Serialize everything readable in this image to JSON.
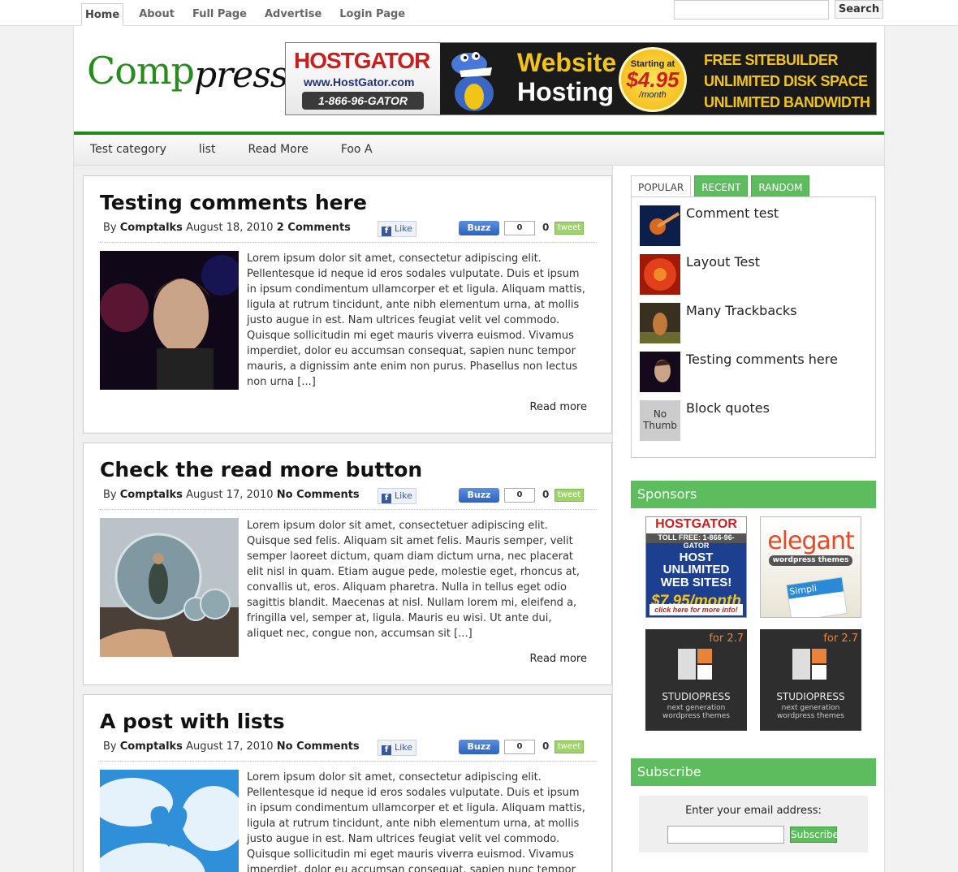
{
  "topnav": {
    "items": [
      {
        "label": "Home"
      },
      {
        "label": "About"
      },
      {
        "label": "Full Page"
      },
      {
        "label": "Advertise"
      },
      {
        "label": "Login Page"
      }
    ],
    "search_button": "Search",
    "search_value": ""
  },
  "header": {
    "logo_part1": "Comp",
    "logo_part2": "press",
    "banner": {
      "brand": "HOSTGATOR",
      "url": "www.HostGator.com",
      "phone": "1-866-96-GATOR",
      "headline1": "Website",
      "headline2": "Hosting",
      "price_prefix": "Starting at",
      "price": "$4.95",
      "price_suffix": "/month",
      "features": [
        "FREE SITEBUILDER",
        "UNLIMITED DISK SPACE",
        "UNLIMITED BANDWIDTH"
      ]
    }
  },
  "catnav": {
    "items": [
      {
        "label": "Test category"
      },
      {
        "label": "list"
      },
      {
        "label": "Read More"
      },
      {
        "label": "Foo A"
      }
    ]
  },
  "posts": [
    {
      "title": "Testing comments here",
      "by": "By",
      "author": "Comptalks",
      "date": "August 18, 2010",
      "comments": "2 Comments",
      "like": "Like",
      "buzz": "Buzz",
      "buzz_count": "0",
      "tweet_count": "0",
      "tweet": "tweet",
      "excerpt": "Lorem ipsum dolor sit amet, consectetur adipiscing elit. Pellentesque id neque id eros sodales vulputate. Duis et ipsum in ipsum condimentum ullamcorper et et ligula. Aliquam mattis, ligula at rutrum tincidunt, ante nibh elementum urna, at mollis justo augue in est. Nam ultrices feugiat velit vel commodo. Quisque sollicitudin mi eget mauris viverra euismod. Vivamus imperdiet, dolor eu accumsan consequat, sapien nunc tempor mauris, a dignissim ante enim non purus. Phasellus non lectus non urna [...]",
      "read_more": "Read more"
    },
    {
      "title": "Check the read more button",
      "by": "By",
      "author": "Comptalks",
      "date": "August 17, 2010",
      "comments": "No Comments",
      "like": "Like",
      "buzz": "Buzz",
      "buzz_count": "0",
      "tweet_count": "0",
      "tweet": "tweet",
      "excerpt": "Lorem ipsum dolor sit amet, consectetuer adipiscing elit. Quisque sed felis. Aliquam sit amet felis. Mauris semper, velit semper laoreet dictum, quam diam dictum urna, nec placerat elit nisl in quam. Etiam augue pede, molestie eget, rhoncus at, convallis ut, eros. Aliquam pharetra. Nulla in tellus eget odio sagittis blandit. Maecenas at nisl. Nullam lorem mi, eleifend a, fringilla vel, semper at, ligula. Mauris eu wisi. Ut ante dui, aliquet nec, congue non, accumsan sit [...]",
      "read_more": "Read more"
    },
    {
      "title": "A post with lists",
      "by": "By",
      "author": "Comptalks",
      "date": "August 17, 2010",
      "comments": "No Comments",
      "like": "Like",
      "buzz": "Buzz",
      "buzz_count": "0",
      "tweet_count": "0",
      "tweet": "tweet",
      "excerpt": "Lorem ipsum dolor sit amet, consectetur adipiscing elit. Pellentesque id neque id eros sodales vulputate. Duis et ipsum in ipsum condimentum ullamcorper et et ligula. Aliquam mattis, ligula at rutrum tincidunt, ante nibh elementum urna, at mollis justo augue in est. Nam ultrices feugiat velit vel commodo. Quisque sollicitudin mi eget mauris viverra euismod. Vivamus imperdiet, dolor eu accumsan consequat, sapien nunc tempor",
      "read_more": ""
    }
  ],
  "sidebar": {
    "tabs": [
      {
        "label": "POPULAR"
      },
      {
        "label": "RECENT"
      },
      {
        "label": "RANDOM"
      }
    ],
    "popular": [
      {
        "title": "Comment test"
      },
      {
        "title": "Layout Test"
      },
      {
        "title": "Many Trackbacks"
      },
      {
        "title": "Testing comments here"
      },
      {
        "title": "Block quotes",
        "no_thumb": "No Thumb"
      }
    ],
    "sponsors_title": "Sponsors",
    "ads": {
      "hostgator": {
        "brand": "HOSTGATOR",
        "tollfree": "TOLL FREE: 1-866-96-GATOR",
        "line1": "HOST UNLIMITED",
        "line2": "WEB SITES!",
        "price": "$7.95/month",
        "cta": "click here for more info!"
      },
      "elegant": {
        "brand": "elegant",
        "sub": "wordpress themes",
        "simple": "Simpli"
      },
      "studiopress": {
        "version": "for 2.7",
        "brand": "STUDIOPRESS",
        "sub1": "next generation",
        "sub2": "wordpress themes"
      }
    },
    "subscribe_title": "Subscribe",
    "subscribe_label": "Enter your email address:",
    "subscribe_button": "Subscribe",
    "email_value": ""
  },
  "colors": {
    "accent_green": "#5dbd5e",
    "header_line": "#1c8a16",
    "logo_green": "#2a8a1f"
  }
}
